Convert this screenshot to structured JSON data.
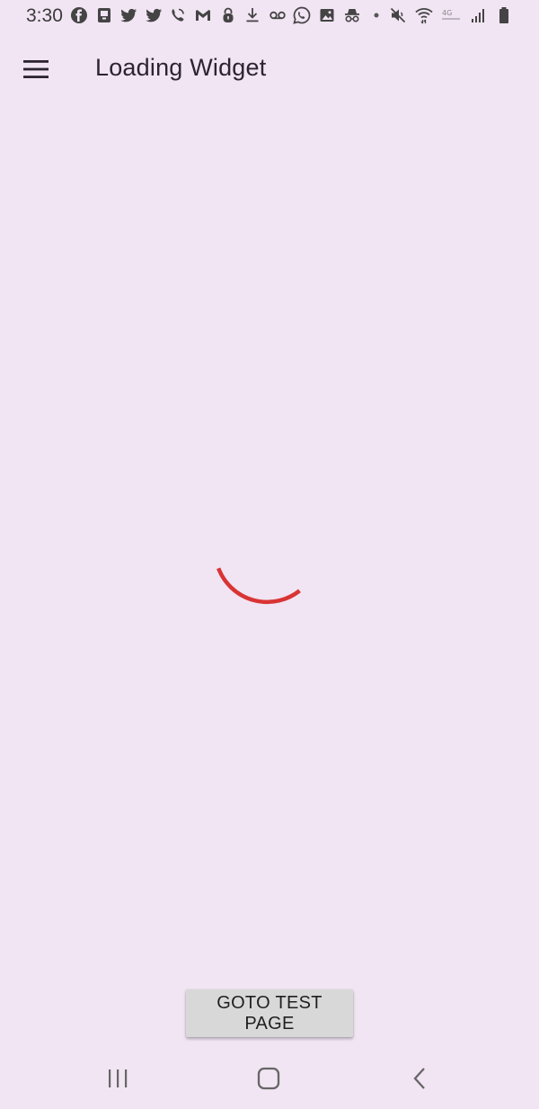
{
  "status_bar": {
    "time": "3:30",
    "left_icons": [
      "facebook-icon",
      "messenger-icon",
      "twitter-icon",
      "twitter-icon",
      "call-icon",
      "gmail-icon",
      "lock-icon",
      "download-icon",
      "voicemail-icon",
      "whatsapp-icon",
      "image-icon",
      "incognito-icon",
      "dot-icon"
    ],
    "right_icons": [
      "mute-icon",
      "wifi-icon",
      "lte-icon",
      "signal-icon",
      "battery-icon"
    ],
    "network_label": "4G"
  },
  "app_bar": {
    "title": "Loading Widget",
    "menu_icon": "hamburger-menu-icon"
  },
  "loading": {
    "spinner_color": "#d93434"
  },
  "actions": {
    "goto_label": "GOTO TEST PAGE"
  },
  "nav_bar": {
    "recents_icon": "recents-icon",
    "home_icon": "home-icon",
    "back_icon": "back-icon"
  },
  "colors": {
    "background": "#f1e4f3",
    "button_bg": "#d8d8d8",
    "spinner": "#d93434"
  }
}
